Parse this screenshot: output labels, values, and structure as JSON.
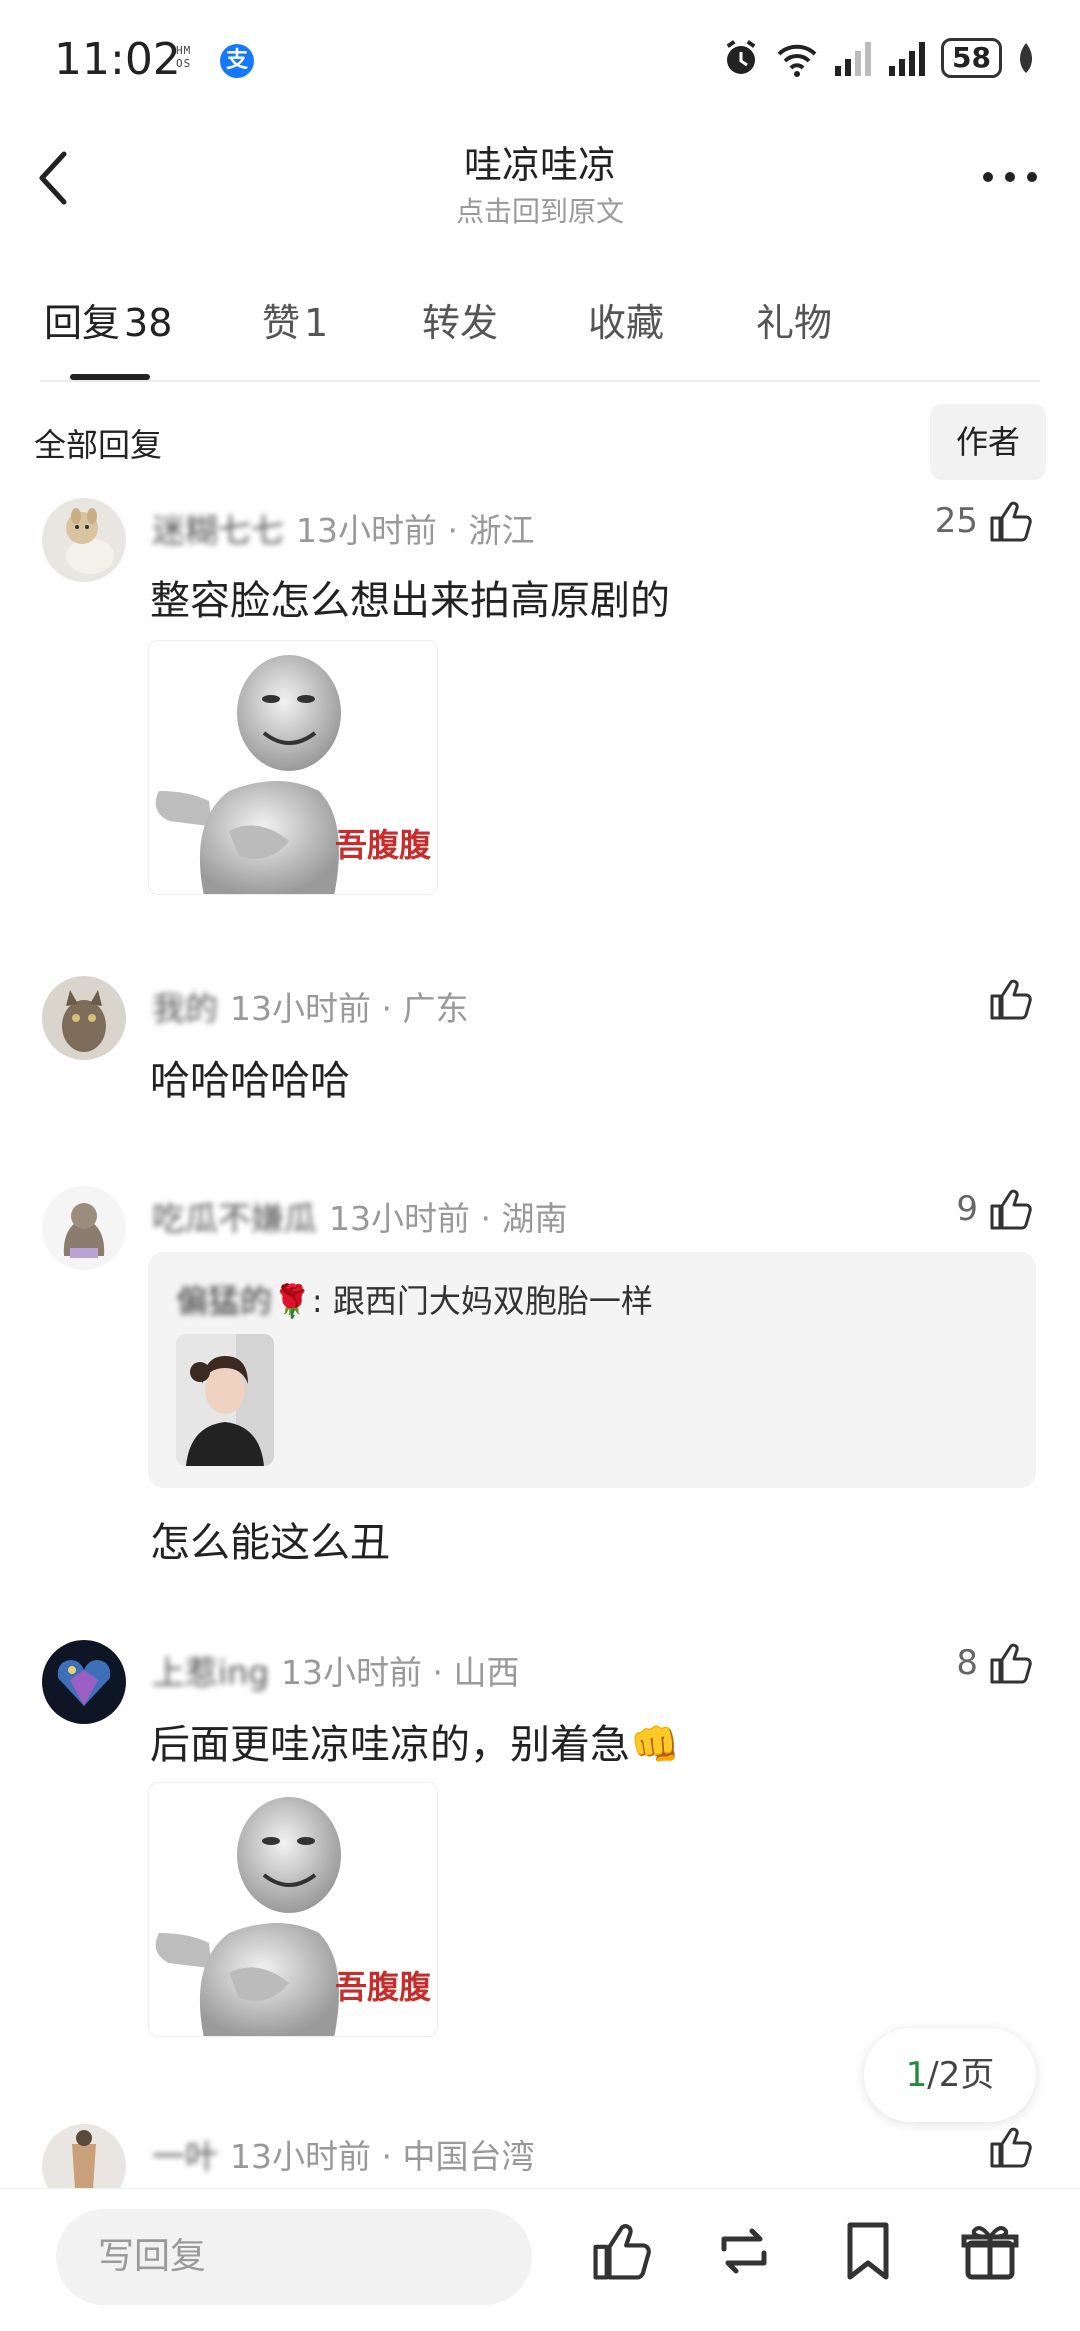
{
  "status_bar": {
    "time": "11:02",
    "hmos": "HM OS",
    "alipay_glyph": "支",
    "battery": "58",
    "icons": [
      "alarm-icon",
      "wifi-icon",
      "signal-icon",
      "signal-icon",
      "battery-icon",
      "leaf-icon"
    ]
  },
  "header": {
    "title": "哇凉哇凉",
    "subtitle": "点击回到原文"
  },
  "tabs": [
    {
      "label": "回复",
      "count": "38",
      "active": true
    },
    {
      "label": "赞",
      "count": "1"
    },
    {
      "label": "转发",
      "count": ""
    },
    {
      "label": "收藏",
      "count": ""
    },
    {
      "label": "礼物",
      "count": ""
    }
  ],
  "filter": {
    "all_label": "全部回复",
    "author_label": "作者"
  },
  "comments": [
    {
      "username": "迷糊七七",
      "time": "13小时前",
      "location": "浙江",
      "likes": "25",
      "text": "整容脸怎么想出来拍高原剧的",
      "meme_text": "吾腹腹"
    },
    {
      "username": "我的",
      "time": "13小时前",
      "location": "广东",
      "likes": "",
      "text": "哈哈哈哈哈"
    },
    {
      "username": "吃瓜不嫌瓜",
      "time": "13小时前",
      "location": "湖南",
      "likes": "9",
      "quote_user": "偏猛的",
      "quote_emoji": "🌹",
      "quote_text": ": 跟西门大妈双胞胎一样",
      "text": "怎么能这么丑"
    },
    {
      "username": "上惹ing",
      "time": "13小时前",
      "location": "山西",
      "likes": "8",
      "text": "后面更哇凉哇凉的，别着急",
      "text_emoji": "👊",
      "meme_text": "吾腹腹"
    },
    {
      "username": "一叶",
      "time": "13小时前",
      "location": "中国台湾",
      "likes": ""
    }
  ],
  "pager": {
    "current": "1",
    "rest": "/2页"
  },
  "bottom_bar": {
    "reply_placeholder": "写回复",
    "icons": [
      "like-icon",
      "repost-icon",
      "bookmark-icon",
      "gift-icon"
    ]
  },
  "colors": {
    "accent_green": "#1f8a3a",
    "meme_red": "#c62d2d"
  }
}
